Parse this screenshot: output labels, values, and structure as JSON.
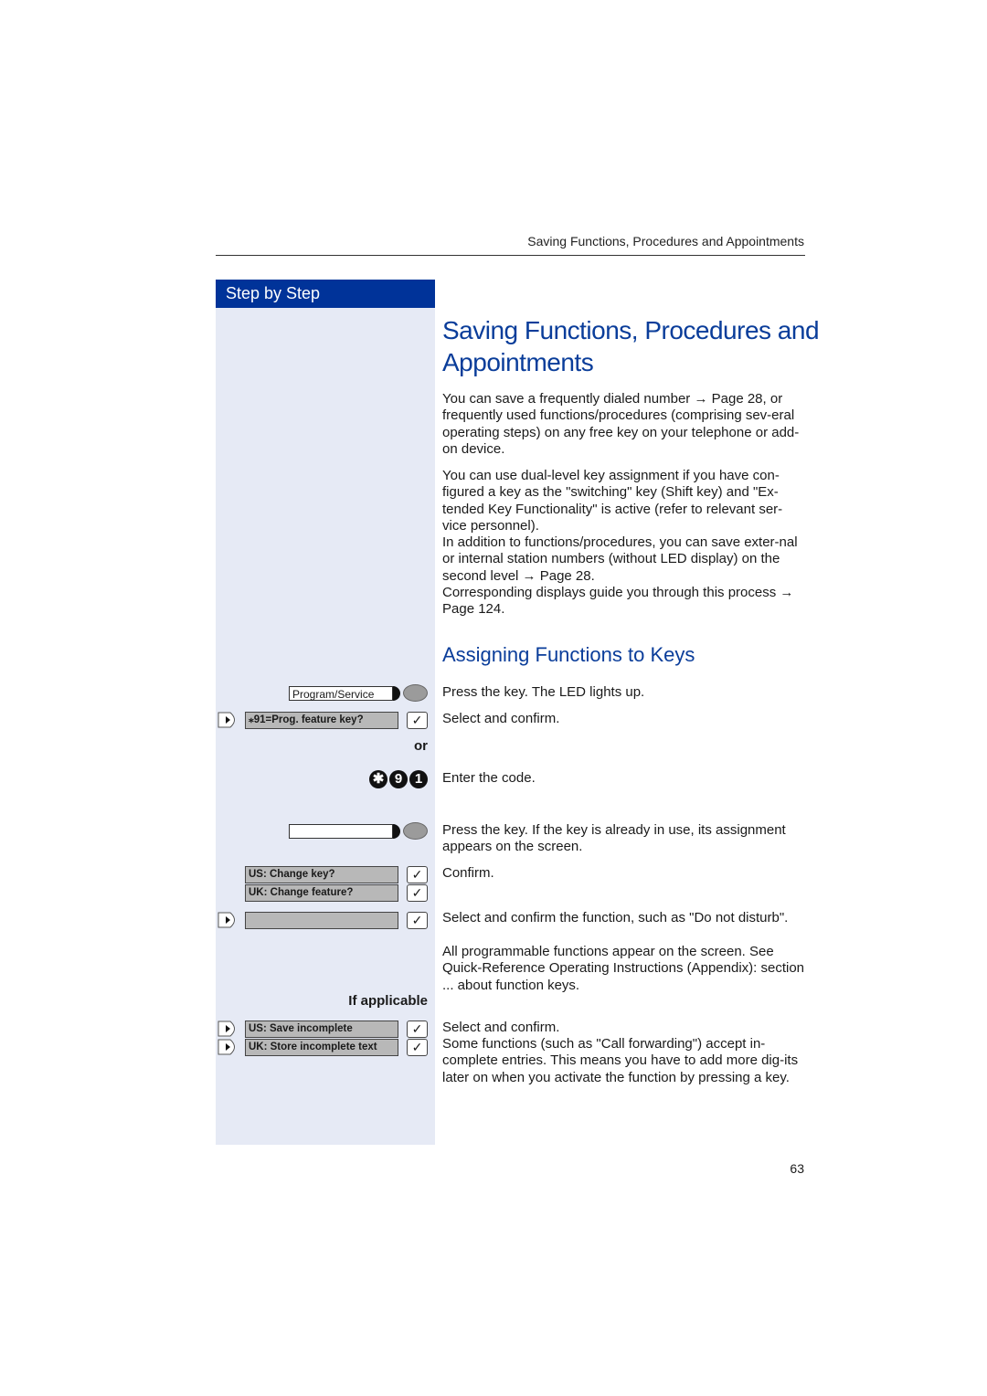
{
  "header": {
    "running_title": "Saving Functions, Procedures and Appointments"
  },
  "sidebar": {
    "heading": "Step by Step"
  },
  "main": {
    "title_line1": "Saving Functions, Procedures and",
    "title_line2": "Appointments",
    "intro_paragraph1": "You can save a frequently dialed number → Page 28, or frequently used functions/procedures (comprising sev-eral operating steps) on any free key on your telephone or add-on device.",
    "intro_paragraph2": "You can use dual-level key assignment if you have con-figured a key as the \"switching\" key (Shift key) and \"Ex-tended Key Functionality\" is active (refer to relevant ser-vice personnel).",
    "intro_paragraph3": "In addition to functions/procedures, you can save exter-nal or internal station numbers (without LED display) on the second level → Page 28.",
    "intro_paragraph4": "Corresponding displays guide you through this process → Page 124.",
    "section_title": "Assigning Functions to Keys"
  },
  "steps": {
    "program_service_key": "Program/Service",
    "prog_feature_display": "⁎91=Prog. feature key?",
    "or_label": "or",
    "code_digits": [
      "✱",
      "9",
      "1"
    ],
    "change_key_us": "US: Change key?",
    "change_feature_uk": "UK: Change feature?",
    "if_applicable": "If applicable",
    "save_incomplete_us": "US: Save incomplete",
    "store_incomplete_uk": "UK: Store incomplete text",
    "checkmark": "✓"
  },
  "instructions": {
    "press_key_led": "Press the key. The LED lights up.",
    "select_confirm_1": "Select and confirm.",
    "enter_code": "Enter the code.",
    "press_key_assignment": "Press the key. If the key is already in use, its assignment appears on the screen.",
    "confirm": "Confirm.",
    "select_function": "Select and confirm the function, such as \"Do not disturb\".",
    "all_programmable": "All programmable functions appear on the screen. See Quick-Reference Operating Instructions (Appendix): section ... about function keys.",
    "select_confirm_2": "Select and confirm.",
    "incomplete_note": "Some functions (such as \"Call forwarding\") accept in-complete entries. This means you have to add more dig-its later on when you activate the function by pressing a key."
  },
  "footer": {
    "page_number": "63"
  },
  "colors": {
    "accent_blue": "#003399",
    "sidebar_bg": "#e6eaf5",
    "title_blue": "#0a3d9a"
  }
}
